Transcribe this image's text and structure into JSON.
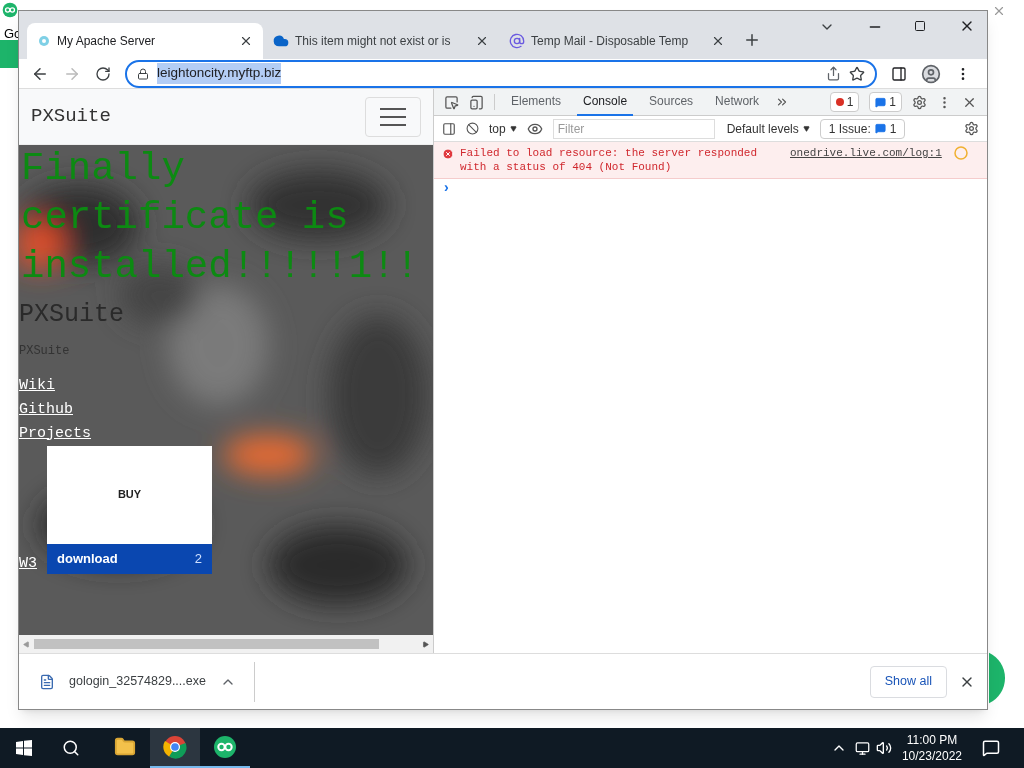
{
  "desktop": {
    "behind_text": "Gc"
  },
  "browser": {
    "tabs": [
      {
        "title": "My Apache Server",
        "kind": "apache",
        "selected": true
      },
      {
        "title": "This item might not exist or is",
        "kind": "cloud",
        "selected": false
      },
      {
        "title": "Temp Mail - Disposable Temp",
        "kind": "mail",
        "selected": false
      }
    ],
    "address": "leightoncity.myftp.biz"
  },
  "page": {
    "brand": "PXSuite",
    "heading": "Finally certificate is installed!!!!!1!!",
    "subtitle": "PXSuite",
    "tagline": "PXSuite",
    "links": [
      "Wiki",
      "Github",
      "Projects"
    ],
    "card": {
      "button": "BUY",
      "label": "download",
      "count": "2"
    },
    "bottom_link": "W3"
  },
  "devtools": {
    "tabs": [
      {
        "label": "Elements",
        "selected": false
      },
      {
        "label": "Console",
        "selected": true
      },
      {
        "label": "Sources",
        "selected": false
      },
      {
        "label": "Network",
        "selected": false
      }
    ],
    "error_count": "1",
    "message_count": "1",
    "context": "top",
    "filter_placeholder": "Filter",
    "levels": "Default levels",
    "issues_label": "1 Issue:",
    "issues_count": "1",
    "messages": [
      {
        "kind": "error",
        "text": "Failed to load resource: the server responded with a status of 404 (Not Found)",
        "source": "onedrive.live.com/log:1"
      }
    ],
    "prompt": "›"
  },
  "downloads": {
    "file": "gologin_32574829....exe",
    "show_all": "Show all"
  },
  "taskbar": {
    "apps": [
      {
        "kind": "folder",
        "selected": false,
        "running": false
      },
      {
        "kind": "chrome",
        "selected": true,
        "running": true
      },
      {
        "kind": "gologin",
        "selected": false,
        "running": true
      }
    ],
    "time": "11:00 PM",
    "date": "10/23/2022"
  }
}
